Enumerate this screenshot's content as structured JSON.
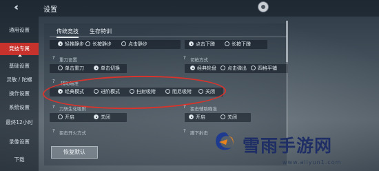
{
  "header": {
    "title": "设置"
  },
  "sidebar": {
    "items": [
      "通用设置",
      "竞技专属",
      "基础设置",
      "灵敏 / 陀螺",
      "操作设置",
      "系统设置",
      "最终12小时",
      "录像设置",
      "下载"
    ],
    "active_index": 1
  },
  "tabs": [
    {
      "label": "传统竞技",
      "active": true
    },
    {
      "label": "生存特训",
      "active": false
    }
  ],
  "rows": {
    "r1_left": [
      "轻推静步",
      "长按静步",
      "点击静步"
    ],
    "r1_right": [
      "点击下蹲",
      "长按下蹲"
    ],
    "r2_left_label": "重刀设置",
    "r2_left": [
      "单击重刀",
      "单击切换"
    ],
    "r2_right_label": "切枪方式",
    "r2_right": [
      "经典轮盘",
      "点击弹出",
      "四格平铺"
    ],
    "r3_label": "辅助瞄准",
    "r3": [
      "经典模式",
      "进阶模式",
      "扫射吸附",
      "阻尼吸附",
      "关闭"
    ],
    "r4_left_label": "刀斩生化吸附",
    "r4_left": [
      "开启",
      "关闭"
    ],
    "r4_right_label": "狙击辅助瞄准",
    "r4_right": [
      "开启",
      "关闭"
    ],
    "r5_left_label": "狙击开火方式",
    "r5_right_label": "蹲下射击"
  },
  "reset_button": "恢复默认",
  "watermark": {
    "text": "雪雨手游网",
    "url": "www.aliyun1.com"
  },
  "colors": {
    "accent": "#c8322d",
    "highlight_ring": "#d8342c"
  }
}
